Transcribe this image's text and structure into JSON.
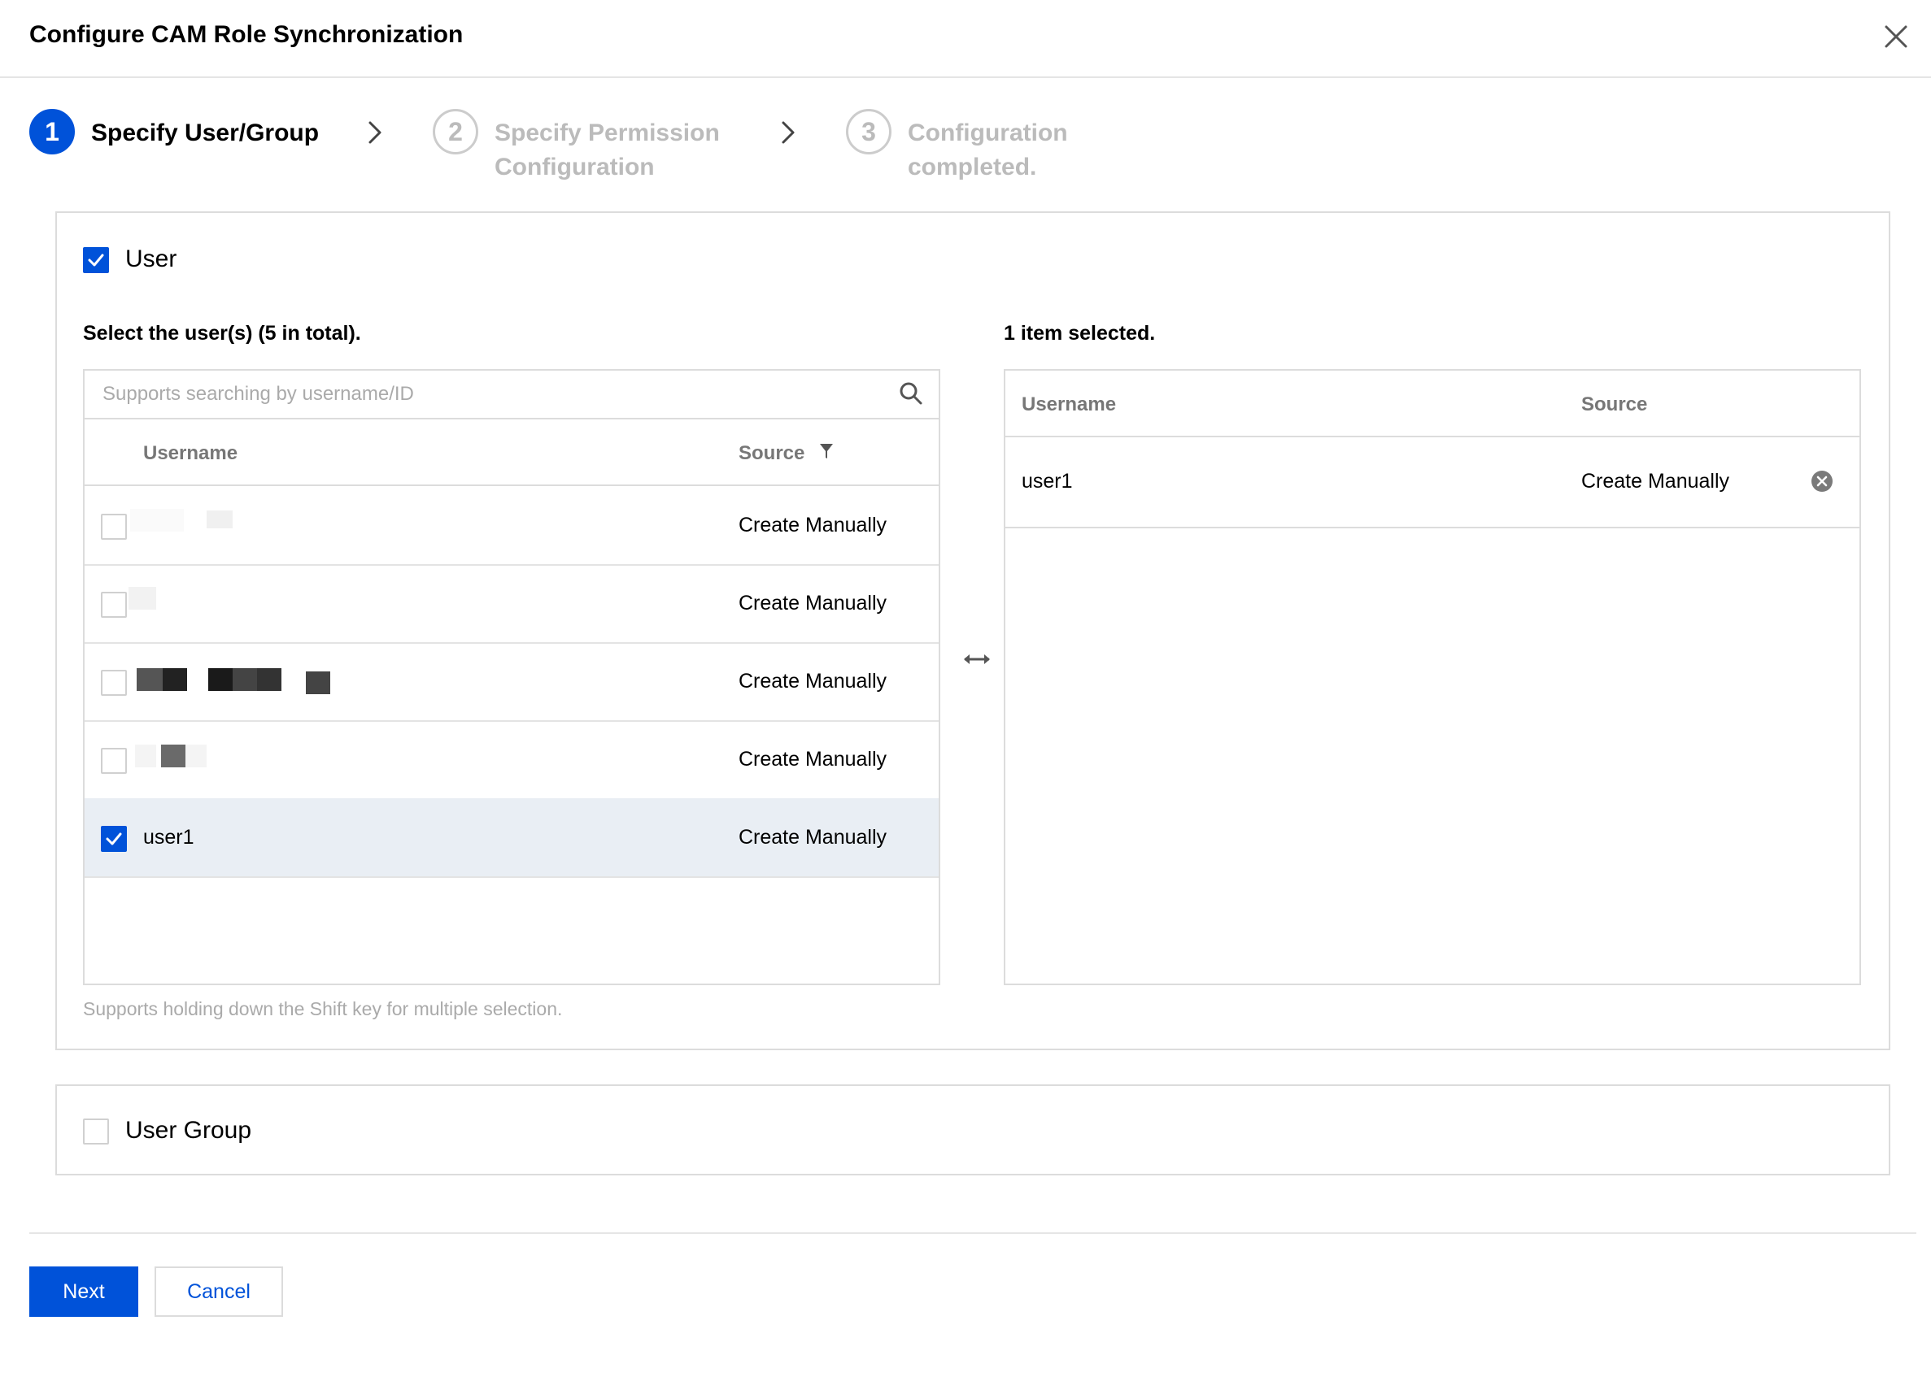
{
  "dialog": {
    "title": "Configure CAM Role Synchronization"
  },
  "steps": [
    {
      "number": "1",
      "label_line1": "Specify User/Group",
      "label_line2": "",
      "state": "active"
    },
    {
      "number": "2",
      "label_line1": "Specify Permission",
      "label_line2": "Configuration",
      "state": "inactive"
    },
    {
      "number": "3",
      "label_line1": "Configuration",
      "label_line2": "completed.",
      "state": "inactive"
    }
  ],
  "user_section": {
    "checkbox_label": "User",
    "checked": true,
    "left_title": "Select the user(s) (5 in total).",
    "search": {
      "placeholder": "Supports searching by username/ID",
      "value": ""
    },
    "columns": {
      "username": "Username",
      "source": "Source"
    },
    "rows": [
      {
        "username": "",
        "source": "Create Manually",
        "checked": false,
        "redacted": true
      },
      {
        "username": "",
        "source": "Create Manually",
        "checked": false,
        "redacted": true
      },
      {
        "username": "",
        "source": "Create Manually",
        "checked": false,
        "redacted": true
      },
      {
        "username": "",
        "source": "Create Manually",
        "checked": false,
        "redacted": true
      },
      {
        "username": "user1",
        "source": "Create Manually",
        "checked": true,
        "redacted": false
      }
    ],
    "right_title": "1 item selected.",
    "selected_columns": {
      "username": "Username",
      "source": "Source"
    },
    "selected_rows": [
      {
        "username": "user1",
        "source": "Create Manually"
      }
    ],
    "hint": "Supports holding down the Shift key for multiple selection."
  },
  "group_section": {
    "checkbox_label": "User Group",
    "checked": false
  },
  "footer": {
    "next_label": "Next",
    "cancel_label": "Cancel"
  },
  "colors": {
    "primary": "#0052d9",
    "selected_row": "#e9eef4",
    "inactive_step": "#bbbbbb"
  },
  "icons": [
    "close-icon",
    "chevron-right-icon",
    "search-icon",
    "filter-icon",
    "transfer-icon",
    "remove-icon",
    "checkmark-icon"
  ]
}
